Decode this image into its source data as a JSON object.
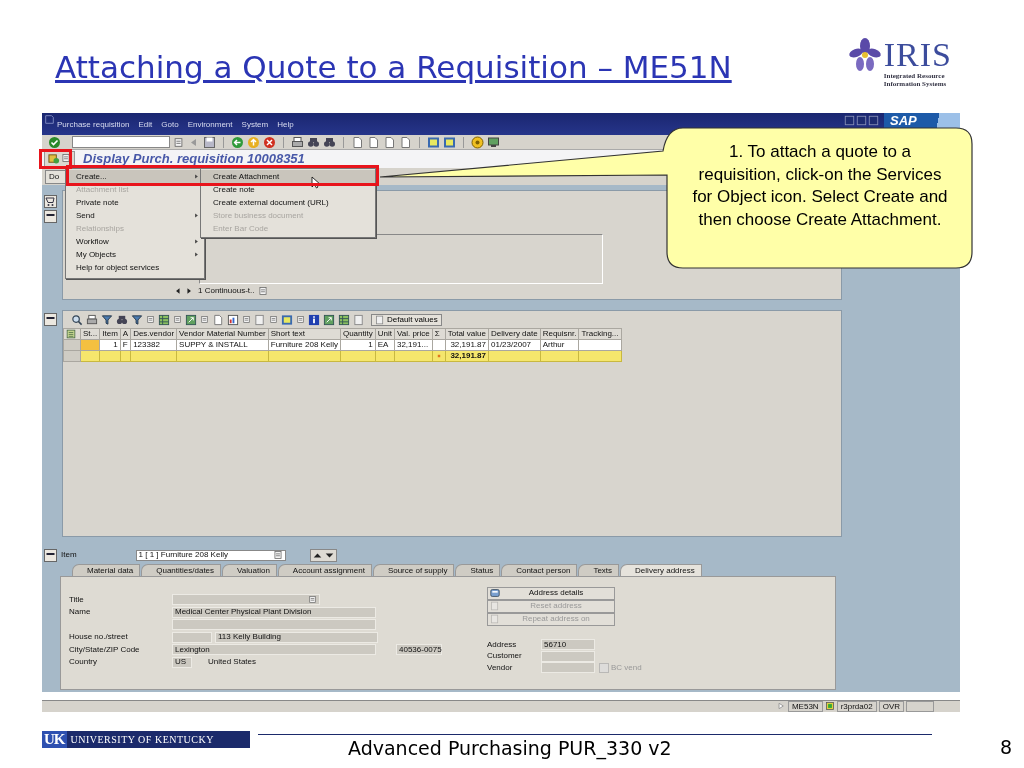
{
  "slide": {
    "title": "Attaching a Quote to a Requisition – ME51N",
    "logo": {
      "name": "IRIS",
      "tagline": [
        "Integrated Resource",
        "Information Systems"
      ]
    }
  },
  "sap_window": {
    "menu_bar": [
      "Purchase requisition",
      "Edit",
      "Goto",
      "Environment",
      "System",
      "Help"
    ],
    "sap_logo": "SAP",
    "title": "Display Purch. requisition 10008351",
    "header_button": "Do",
    "services_menu": [
      {
        "label": "Create...",
        "disabled": false,
        "submenu": true,
        "selected": true
      },
      {
        "label": "Attachment list",
        "disabled": true,
        "submenu": false,
        "selected": false
      },
      {
        "label": "Private note",
        "disabled": false,
        "submenu": false,
        "selected": false
      },
      {
        "label": "Send",
        "disabled": false,
        "submenu": true,
        "selected": false
      },
      {
        "label": "Relationships",
        "disabled": true,
        "submenu": false,
        "selected": false
      },
      {
        "label": "Workflow",
        "disabled": false,
        "submenu": true,
        "selected": false
      },
      {
        "label": "My Objects",
        "disabled": false,
        "submenu": true,
        "selected": false
      },
      {
        "label": "Help for object services",
        "disabled": false,
        "submenu": false,
        "selected": false
      }
    ],
    "create_submenu": [
      {
        "label": "Create Attachment",
        "disabled": false,
        "selected": true
      },
      {
        "label": "Create note",
        "disabled": false,
        "selected": false
      },
      {
        "label": "Create external document (URL)",
        "disabled": false,
        "selected": false
      },
      {
        "label": "Store business document",
        "disabled": true,
        "selected": false
      },
      {
        "label": "Enter Bar Code",
        "disabled": true,
        "selected": false
      }
    ],
    "header_panel": {
      "text_selector": "1 Continuous-t.."
    },
    "items": {
      "default_values_button": "Default values",
      "columns": [
        "St...",
        "Item",
        "A",
        "Des.vendor",
        "Vendor Material Number",
        "Short text",
        "Quantity",
        "Unit",
        "Val. price",
        "Σ",
        "Total value",
        "Delivery date",
        "Requisnr.",
        "Tracking..."
      ],
      "rows": [
        [
          null,
          "1",
          "F",
          "123382",
          "SUPPY & INSTALL",
          "Furniture 208 Kelly",
          "1",
          "EA",
          "32,191...",
          null,
          "32,191.87",
          "01/23/2007",
          "Arthur",
          null
        ]
      ],
      "total": "32,191.87"
    },
    "item_detail": {
      "label": "Item",
      "selector": "1 [ 1 ] Furniture 208 Kelly",
      "tabs": [
        {
          "label": "Material data",
          "selected": false
        },
        {
          "label": "Quantities/dates",
          "selected": false
        },
        {
          "label": "Valuation",
          "selected": false
        },
        {
          "label": "Account assignment",
          "selected": false
        },
        {
          "label": "Source of supply",
          "selected": false
        },
        {
          "label": "Status",
          "selected": false
        },
        {
          "label": "Contact person",
          "selected": false
        },
        {
          "label": "Texts",
          "selected": false
        },
        {
          "label": "Delivery address",
          "selected": true
        }
      ],
      "address": {
        "title_label": "Title",
        "name_label": "Name",
        "name": "Medical Center Physical Plant Division",
        "street_label": "House no./street",
        "street": "113 Kelly Building",
        "city_label": "City/State/ZIP Code",
        "city": "Lexington",
        "zip": "40536-0075",
        "country_label": "Country",
        "country_code": "US",
        "country": "United States"
      },
      "address_buttons": [
        {
          "label": "Address details",
          "disabled": false
        },
        {
          "label": "Reset address",
          "disabled": true
        },
        {
          "label": "Repeat address on",
          "disabled": true
        }
      ],
      "numbers": {
        "address_label": "Address",
        "address": "56710",
        "customer_label": "Customer",
        "vendor_label": "Vendor",
        "bc_vend": {
          "label": "BC vend",
          "checked": false,
          "disabled": true
        }
      }
    },
    "status_bar": {
      "transaction": "ME53N",
      "server": "r3prda02",
      "mode": "OVR"
    }
  },
  "callout": {
    "text": "1. To attach a quote to a requisition, click-on the Services for Object icon. Select Create and then choose Create Attachment."
  },
  "footer": {
    "university_mark": "UK",
    "university": "UNIVERSITY OF KENTUCKY",
    "course": "Advanced Purchasing PUR_330 v2",
    "page": "8"
  }
}
